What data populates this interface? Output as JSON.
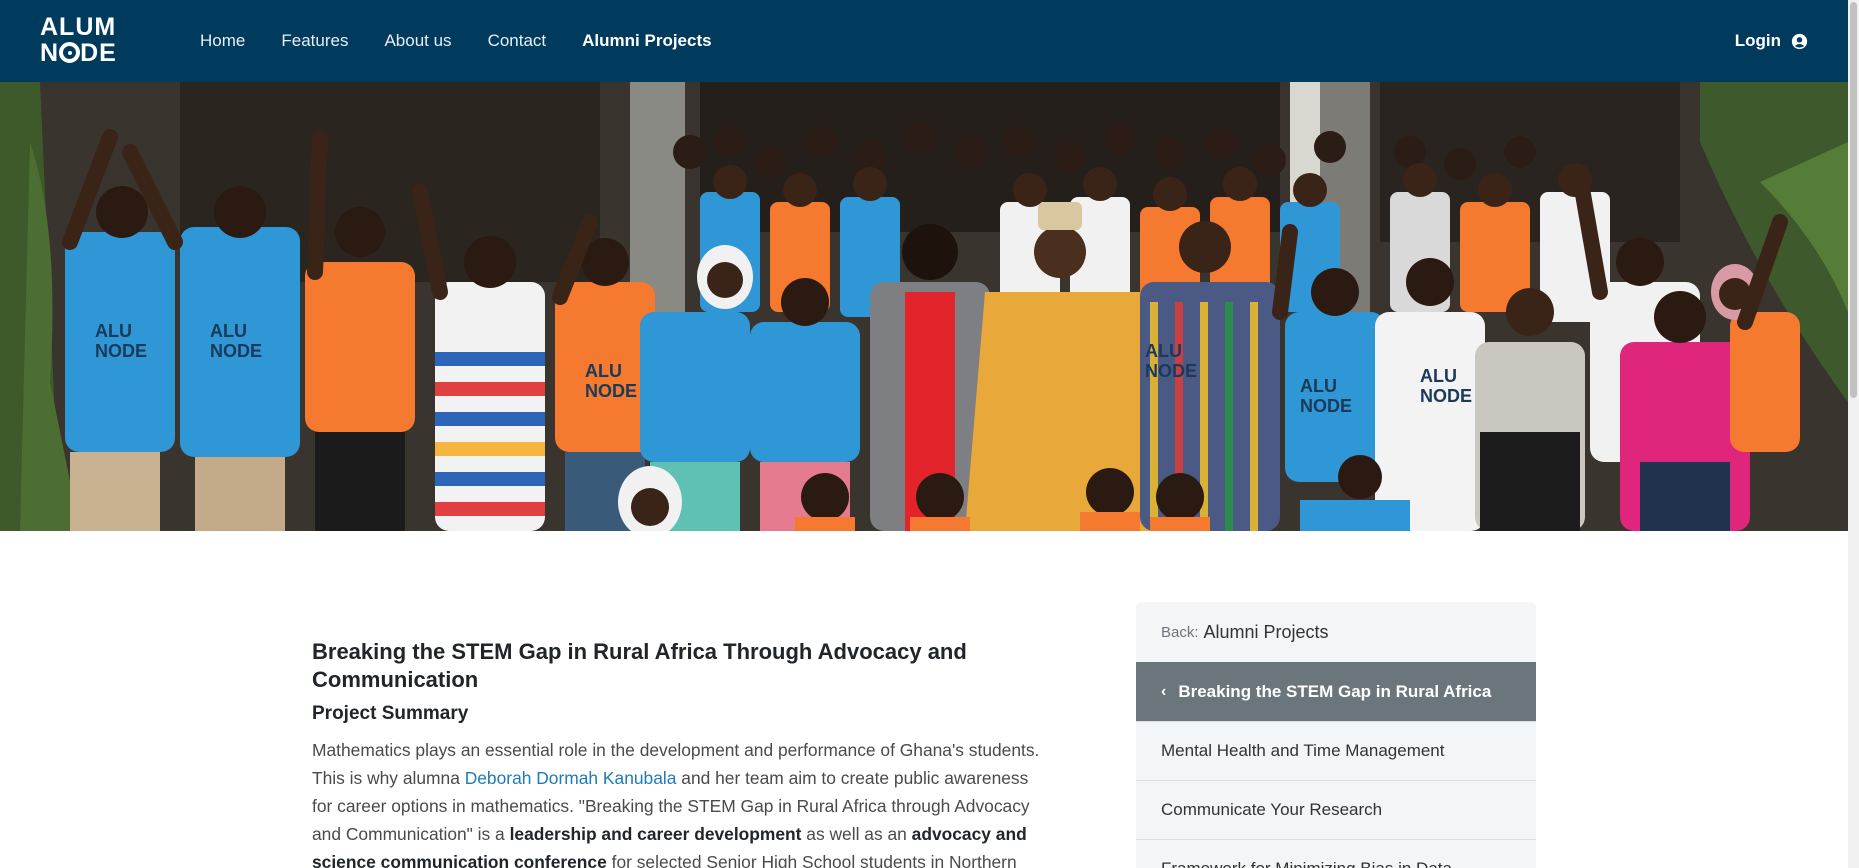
{
  "brand": {
    "line1": "ALUM",
    "line2_pre": "N",
    "line2_post": "DE"
  },
  "nav": {
    "items": [
      {
        "label": "Home"
      },
      {
        "label": "Features"
      },
      {
        "label": "About us"
      },
      {
        "label": "Contact"
      },
      {
        "label": "Alumni Projects"
      }
    ],
    "login_label": "Login"
  },
  "hero": {
    "shirt_text": "ALU NODE",
    "colors": {
      "blue": "#2f97d6",
      "orange": "#f5792f",
      "white": "#f1f1f1",
      "pink": "#e0267c",
      "gold": "#e9a83a"
    }
  },
  "article": {
    "title": "Breaking the STEM Gap in Rural Africa Through Advocacy and Communication",
    "section_heading": "Project Summary",
    "p1_a": "Mathematics plays an essential role in the development and performance of Ghana's students. This is why alumna ",
    "p1_link": "Deborah Dormah Kanubala",
    "p1_b": " and her team aim to create public awareness for career options in mathematics. \"Breaking the STEM Gap in Rural Africa through Advocacy and Communication\" is a ",
    "p1_bold1": "leadership and career development",
    "p1_c": " as well as an ",
    "p1_bold2": "advocacy and science communication conference",
    "p1_d": " for selected Senior High School students in Northern"
  },
  "sidebar": {
    "back_prefix": "Back:",
    "back_label": "Alumni Projects",
    "items": [
      {
        "label": "Breaking the STEM Gap in Rural Africa"
      },
      {
        "label": "Mental Health and Time Management"
      },
      {
        "label": "Communicate Your Research"
      },
      {
        "label": "Framework for Minimizing Bias in Data"
      }
    ]
  }
}
